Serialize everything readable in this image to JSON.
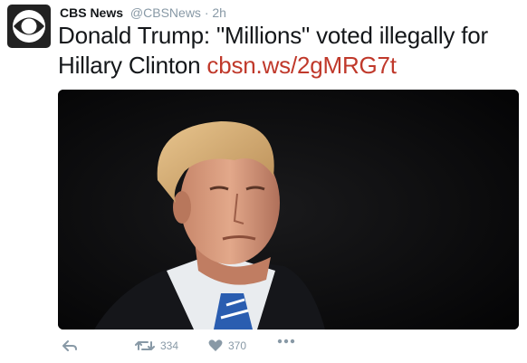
{
  "tweet": {
    "author_name": "CBS News",
    "author_handle": "@CBSNews",
    "separator": "·",
    "timestamp": "2h",
    "text": "Donald Trump: \"Millions\" voted illegally for Hillary Clinton",
    "link": "cbsn.ws/2gMRG7t",
    "avatar_icon": "cbs-eye-logo-icon",
    "media_icon": "photo-of-man-in-suit"
  },
  "actions": {
    "reply_icon": "reply-icon",
    "retweet_icon": "retweet-icon",
    "retweet_count": "334",
    "like_icon": "heart-icon",
    "like_count": "370",
    "more_icon": "more-dots-icon"
  },
  "colors": {
    "link": "#c0392b",
    "muted": "#8899a6",
    "text": "#14171a",
    "avatar_bg": "#222222"
  }
}
